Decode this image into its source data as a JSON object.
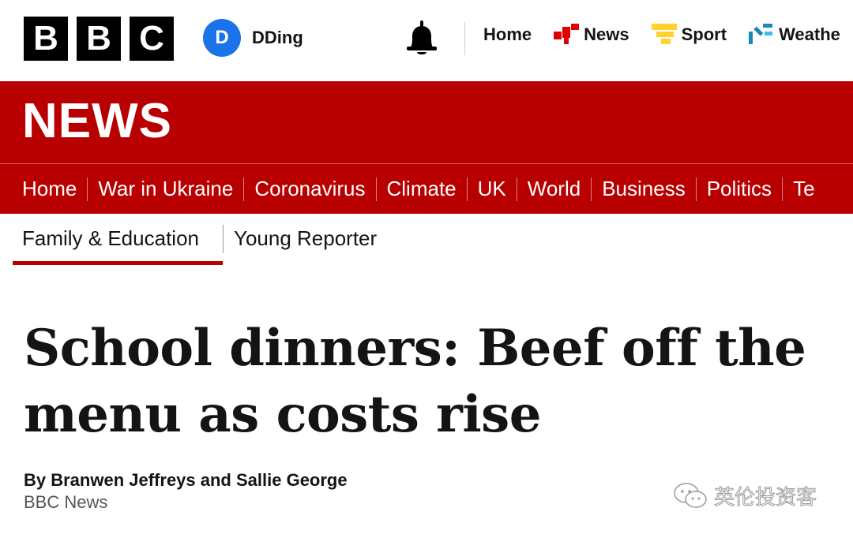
{
  "brand": {
    "letters": [
      "B",
      "B",
      "C"
    ]
  },
  "account": {
    "initial": "D",
    "name": "DDing",
    "avatar_color": "#1a73e8"
  },
  "top_nav": [
    {
      "label": "Home",
      "icon": "none"
    },
    {
      "label": "News",
      "icon": "news-icon"
    },
    {
      "label": "Sport",
      "icon": "sport-icon"
    },
    {
      "label": "Weathe",
      "icon": "weather-icon"
    }
  ],
  "banner": {
    "title": "NEWS",
    "color": "#b80000"
  },
  "section_nav": [
    "Home",
    "War in Ukraine",
    "Coronavirus",
    "Climate",
    "UK",
    "World",
    "Business",
    "Politics",
    "Te"
  ],
  "subnav": {
    "active": "Family & Education",
    "other": "Young Reporter"
  },
  "article": {
    "headline": "School dinners: Beef off the menu as costs rise",
    "byline": "By Branwen Jeffreys and Sallie George",
    "source": "BBC News"
  },
  "watermark": {
    "text": "英伦投资客"
  }
}
